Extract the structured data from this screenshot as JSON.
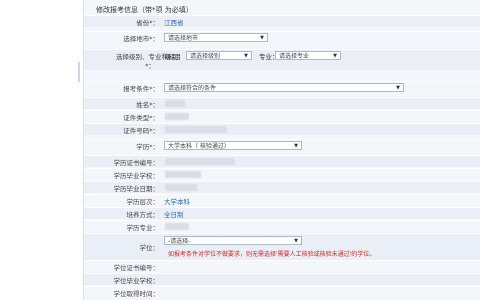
{
  "form": {
    "title": "修改报考信息（带*项 为必填）",
    "province": {
      "label": "省份*：",
      "value": "江西省"
    },
    "city": {
      "label": "选择地市*：",
      "value": "请选择地市"
    },
    "level": {
      "label": "选择级别、专业和科目",
      "star": "*：",
      "level_label": "级别：",
      "level_value": "请选择级别",
      "major_label": "专业：",
      "major_value": "请选择专业"
    },
    "condition": {
      "label": "报考条件*：",
      "value": "请选择符合的条件"
    },
    "name": {
      "label": "姓名*："
    },
    "id_type": {
      "label": "证件类型*："
    },
    "id_no": {
      "label": "证件号码*："
    },
    "education": {
      "label": "学历*：",
      "value": "大学本科（ 核验通过）"
    },
    "edu_cert_no": {
      "label": "学历证书编号："
    },
    "edu_school": {
      "label": "学历毕业学校："
    },
    "edu_date": {
      "label": "学历毕业日期："
    },
    "edu_level": {
      "label": "学历层次：",
      "value": "大学本科"
    },
    "study_mode": {
      "label": "培养方式：",
      "value": "全日制"
    },
    "edu_major": {
      "label": "学历专业："
    },
    "degree": {
      "label": "学位：",
      "value": "-请选择-",
      "hint": "如报考条件对学位不做要求，则无需选择'需要人工核验或核验未通过'的学位。"
    },
    "degree_cert_no": {
      "label": "学位证书编号："
    },
    "degree_school": {
      "label": "学位毕业学校："
    },
    "degree_date": {
      "label": "学位取得时间："
    }
  }
}
